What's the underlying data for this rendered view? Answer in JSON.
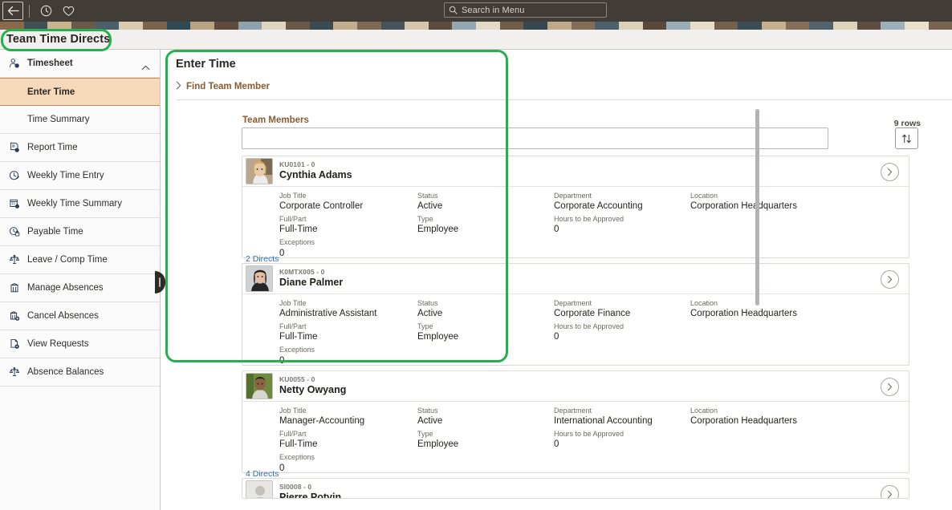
{
  "header": {
    "back_icon": "back-arrow-icon",
    "recent_icon": "clock-icon",
    "favorites_icon": "heart-icon",
    "search_placeholder": "Search in Menu",
    "search_icon": "search-icon"
  },
  "page": {
    "title": "Team Time Directs"
  },
  "sidebar": {
    "group": {
      "label": "Timesheet",
      "icon": "person-clock-icon",
      "chevron": "chevron-up-icon"
    },
    "sub_items": [
      {
        "label": "Enter Time",
        "active": true
      },
      {
        "label": "Time Summary",
        "active": false
      }
    ],
    "items": [
      {
        "label": "Report Time",
        "icon": "report-time-icon"
      },
      {
        "label": "Weekly Time Entry",
        "icon": "clock-edit-icon"
      },
      {
        "label": "Weekly Time Summary",
        "icon": "calendar-clock-icon"
      },
      {
        "label": "Payable Time",
        "icon": "payable-time-icon"
      },
      {
        "label": "Leave / Comp Time",
        "icon": "scales-icon"
      },
      {
        "label": "Manage Absences",
        "icon": "building-icon"
      },
      {
        "label": "Cancel Absences",
        "icon": "building-x-icon"
      },
      {
        "label": "View Requests",
        "icon": "document-view-icon"
      },
      {
        "label": "Absence Balances",
        "icon": "scales-icon"
      }
    ],
    "collapse_handle": "sidebar-collapse-handle"
  },
  "main": {
    "title": "Enter Time",
    "find_team_member": {
      "label": "Find Team Member",
      "chevron": "chevron-right-icon"
    },
    "team_members_label": "Team Members",
    "team_members_value": "",
    "rows_count": "9 rows",
    "sort_icon": "sort-updown-icon",
    "field_labels": {
      "job_title": "Job Title",
      "status": "Status",
      "department": "Department",
      "location": "Location",
      "full_part": "Full/Part",
      "type": "Type",
      "hours_to_be_approved": "Hours to be Approved",
      "exceptions": "Exceptions"
    },
    "cards": [
      {
        "emp_id": "KU0101 - 0",
        "name": "Cynthia Adams",
        "job_title": "Corporate Controller",
        "status": "Active",
        "department": "Corporate Accounting",
        "location": "Corporation Headquarters",
        "full_part": "Full-Time",
        "type": "Employee",
        "hours_to_be_approved": "0",
        "exceptions": "0",
        "directs": "2 Directs",
        "avatar": "photo-female-blonde",
        "go_icon": "chevron-right-circle-icon"
      },
      {
        "emp_id": "K0MTX005 - 0",
        "name": "Diane Palmer",
        "job_title": "Administrative Assistant",
        "status": "Active",
        "department": "Corporate Finance",
        "location": "Corporation Headquarters",
        "full_part": "Full-Time",
        "type": "Employee",
        "hours_to_be_approved": "0",
        "exceptions": "0",
        "directs": "",
        "avatar": "photo-female-dark-hair",
        "go_icon": "chevron-right-circle-icon"
      },
      {
        "emp_id": "KU0055 - 0",
        "name": "Netty Owyang",
        "job_title": "Manager-Accounting",
        "status": "Active",
        "department": "International Accounting",
        "location": "Corporation Headquarters",
        "full_part": "Full-Time",
        "type": "Employee",
        "hours_to_be_approved": "0",
        "exceptions": "0",
        "directs": "4 Directs",
        "avatar": "photo-person-green",
        "go_icon": "chevron-right-circle-icon"
      },
      {
        "emp_id": "SI0008 - 0",
        "name": "Pierre Potvin",
        "job_title": "",
        "status": "",
        "department": "",
        "location": "",
        "full_part": "",
        "type": "",
        "hours_to_be_approved": "",
        "exceptions": "",
        "directs": "",
        "avatar": "placeholder-silhouette",
        "go_icon": "chevron-right-circle-icon"
      }
    ]
  },
  "annotations": {
    "color": "#22b14c"
  },
  "banner_colors": [
    "#8a6a4a",
    "#3f4f58",
    "#c9b48f",
    "#6b5a4a",
    "#4a5f6b",
    "#d8cbb0",
    "#7a6450",
    "#2f4a55",
    "#b9a383",
    "#5e4b3c",
    "#8fa3ad",
    "#e0d5c0",
    "#6a5848",
    "#3a4a52",
    "#c2ae8c",
    "#7d6a55",
    "#46535c",
    "#d4c7ad",
    "#5c4c3e",
    "#94a7b0",
    "#e5dac5",
    "#6f5c49",
    "#37474f",
    "#bfa98a",
    "#826d58",
    "#4e6069",
    "#dbd0b8",
    "#5a493b",
    "#9aadb6",
    "#e8ddc9",
    "#73604d",
    "#3c4c54",
    "#c5b08e",
    "#866f5a",
    "#51636c",
    "#ded3bb",
    "#5e4d3f",
    "#9db0b9",
    "#ebe0cc",
    "#776450"
  ]
}
